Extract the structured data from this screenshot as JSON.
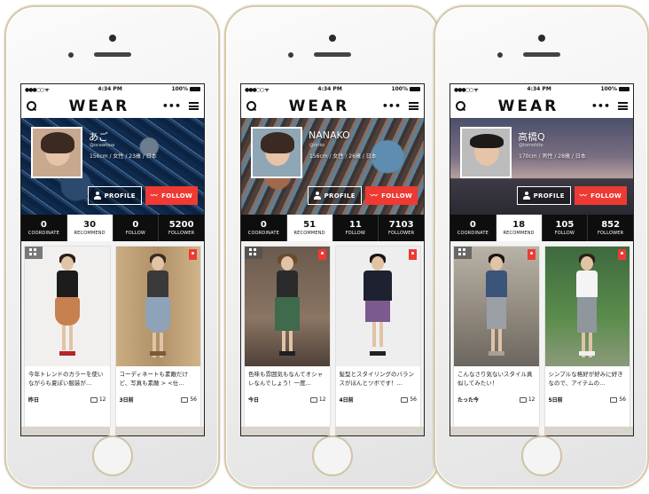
{
  "phones": [
    {
      "status": {
        "signal": "●●●○○ ᯤ",
        "time": "4:34 PM",
        "battery": "100%"
      },
      "logo": "WEAR",
      "profile": {
        "name": "あご",
        "id": "@ocaaroua",
        "info": "156cm / 女性 / 23歳 / 日本"
      },
      "buttons": {
        "profile": "PROFILE",
        "follow": "FOLLOW"
      },
      "stats": [
        {
          "num": "0",
          "label": "COORDINATE"
        },
        {
          "num": "30",
          "label": "RECOMMEND"
        },
        {
          "num": "0",
          "label": "FOLLOW"
        },
        {
          "num": "5200",
          "label": "FOLLOWER"
        }
      ],
      "cards": [
        {
          "text": "今年トレンドのカラーを使いながらも夏ぽい服装が...",
          "date": "昨日",
          "comments": "12"
        },
        {
          "text": "コーディネートも素敵だけど、写真も素敵 > <仕...",
          "date": "3日前",
          "comments": "56"
        }
      ]
    },
    {
      "status": {
        "signal": "●●●○○ ᯤ",
        "time": "4:34 PM",
        "battery": "100%"
      },
      "logo": "WEAR",
      "profile": {
        "name": "NANAKO",
        "id": "@nnko",
        "info": "156cm / 女性 / 26歳 / 日本"
      },
      "buttons": {
        "profile": "PROFILE",
        "follow": "FOLLOW"
      },
      "stats": [
        {
          "num": "0",
          "label": "COORDINATE"
        },
        {
          "num": "51",
          "label": "RECOMMEND"
        },
        {
          "num": "11",
          "label": "FOLLOW"
        },
        {
          "num": "7103",
          "label": "FOLLOWER"
        }
      ],
      "cards": [
        {
          "text": "色味も雰囲気もなんてオシャレなんでしょう！一度...",
          "date": "今日",
          "comments": "12"
        },
        {
          "text": "髪型とスタイリングのバランスがほんとツボです！...",
          "date": "4日前",
          "comments": "56"
        }
      ]
    },
    {
      "status": {
        "signal": "●●●○○ ᯤ",
        "time": "4:34 PM",
        "battery": "100%"
      },
      "logo": "WEAR",
      "profile": {
        "name": "高橋Q",
        "id": "@tomohito",
        "info": "170cm / 男性 / 28歳 / 日本"
      },
      "buttons": {
        "profile": "PROFILE",
        "follow": "FOLLOW"
      },
      "stats": [
        {
          "num": "0",
          "label": "COORDINATE"
        },
        {
          "num": "18",
          "label": "RECOMMEND"
        },
        {
          "num": "105",
          "label": "FOLLOW"
        },
        {
          "num": "852",
          "label": "FOLLOWER"
        }
      ],
      "cards": [
        {
          "text": "こんなさり気ないスタイル真似してみたい！",
          "date": "たった今",
          "comments": "12"
        },
        {
          "text": "シンプルな格好が好みに好きなので、アイテムの...",
          "date": "5日前",
          "comments": "56"
        }
      ]
    }
  ],
  "icons": {
    "search": "search-icon",
    "more": "more-icon",
    "menu": "menu-icon",
    "person": "person-icon",
    "rss": "rss-icon",
    "comment": "comment-icon",
    "bookmark": "bookmark-icon",
    "grid": "grid-icon"
  },
  "colors": {
    "accent": "#ee3a32",
    "stats_bg": "#0e0e0e",
    "active_tab": "#ffffff"
  }
}
